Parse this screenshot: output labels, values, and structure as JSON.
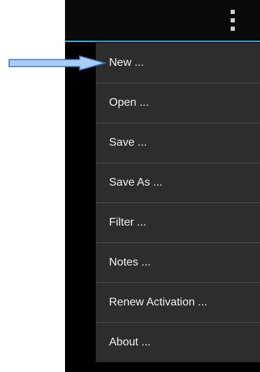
{
  "action_bar": {
    "overflow_icon": "vertical-ellipsis"
  },
  "menu": {
    "items": [
      {
        "label": "New ..."
      },
      {
        "label": "Open ..."
      },
      {
        "label": "Save ..."
      },
      {
        "label": "Save As ..."
      },
      {
        "label": "Filter ..."
      },
      {
        "label": "Notes ..."
      },
      {
        "label": "Renew Activation ..."
      },
      {
        "label": "About ..."
      }
    ]
  },
  "colors": {
    "accent": "#33b5e5",
    "menu_background": "#2d2d2d",
    "menu_divider": "#4a4a4a",
    "arrow_fill": "#a9cdf5",
    "arrow_stroke": "#3a78c4"
  }
}
